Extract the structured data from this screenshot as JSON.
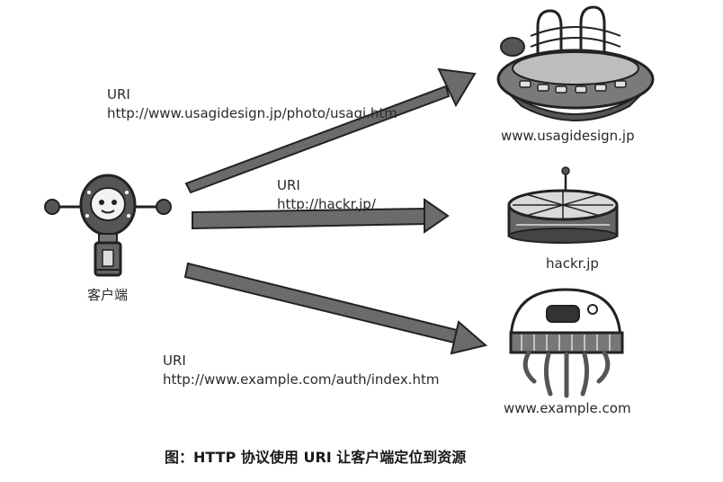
{
  "client": {
    "label": "客户端"
  },
  "arrows": [
    {
      "label": "URI",
      "uri": "http://www.usagidesign.jp/photo/usagi.htm"
    },
    {
      "label": "URI",
      "uri": "http://hackr.jp/"
    },
    {
      "label": "URI",
      "uri": "http://www.example.com/auth/index.htm"
    }
  ],
  "servers": [
    {
      "label": "www.usagidesign.jp",
      "icon": "ufo-server-icon"
    },
    {
      "label": "hackr.jp",
      "icon": "disc-server-icon"
    },
    {
      "label": "www.example.com",
      "icon": "jellyfish-server-icon"
    }
  ],
  "caption": "图：HTTP 协议使用 URI 让客户端定位到资源"
}
